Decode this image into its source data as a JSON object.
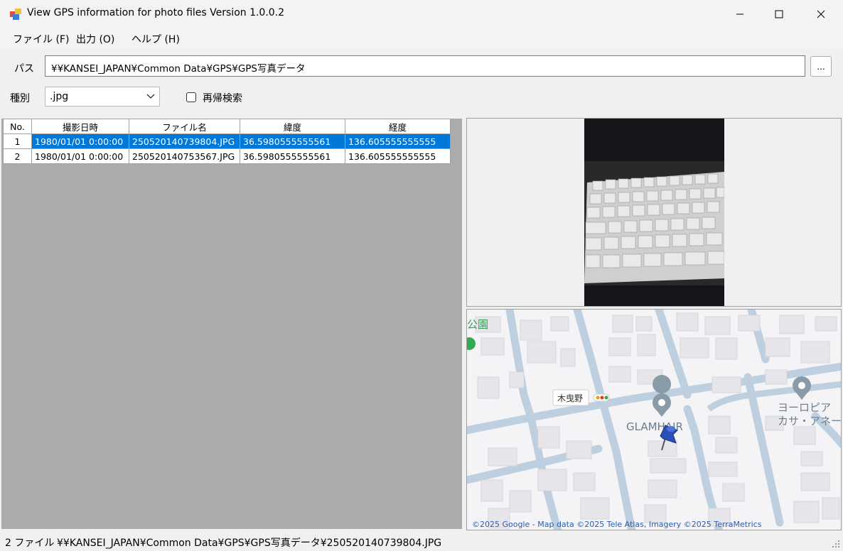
{
  "window": {
    "title": "View GPS information for photo files  Version 1.0.0.2"
  },
  "menu": {
    "file": "ファイル (F)",
    "output": "出力 (O)",
    "help": "ヘルプ (H)"
  },
  "path": {
    "label": "パス",
    "value": "¥¥KANSEI_JAPAN¥Common Data¥GPS¥GPS写真データ",
    "browse": "..."
  },
  "filter": {
    "type_label": "種別",
    "type_value": ".jpg",
    "recursive_label": "再帰検索",
    "recursive_checked": false
  },
  "grid": {
    "columns": [
      "No.",
      "撮影日時",
      "ファイル名",
      "緯度",
      "経度"
    ],
    "rows": [
      {
        "no": "1",
        "date": "1980/01/01 0:00:00",
        "file": "250520140739804.JPG",
        "lat": "36.5980555555561",
        "lon": "136.605555555555",
        "selected": true
      },
      {
        "no": "2",
        "date": "1980/01/01 0:00:00",
        "file": "250520140753567.JPG",
        "lat": "36.5980555555561",
        "lon": "136.605555555555",
        "selected": false
      }
    ]
  },
  "map": {
    "label_park": "公園",
    "label_station": "木曳野",
    "label_place": "GLAMHAIR",
    "label_building_1": "ヨーロピア",
    "label_building_2": "カサ・アネー",
    "attribution": "©2025 Google - Map data ©2025 Tele Atlas, Imagery ©2025 TerraMetrics"
  },
  "status": {
    "count": "2 ファイル",
    "current_path": "¥¥KANSEI_JAPAN¥Common Data¥GPS¥GPS写真データ¥250520140739804.JPG"
  },
  "colors": {
    "selection": "#0078d7",
    "grid_background": "#ababab",
    "map_road": "#bed0df",
    "map_building": "#e6e6ea",
    "pin": "#2b4fb8"
  }
}
